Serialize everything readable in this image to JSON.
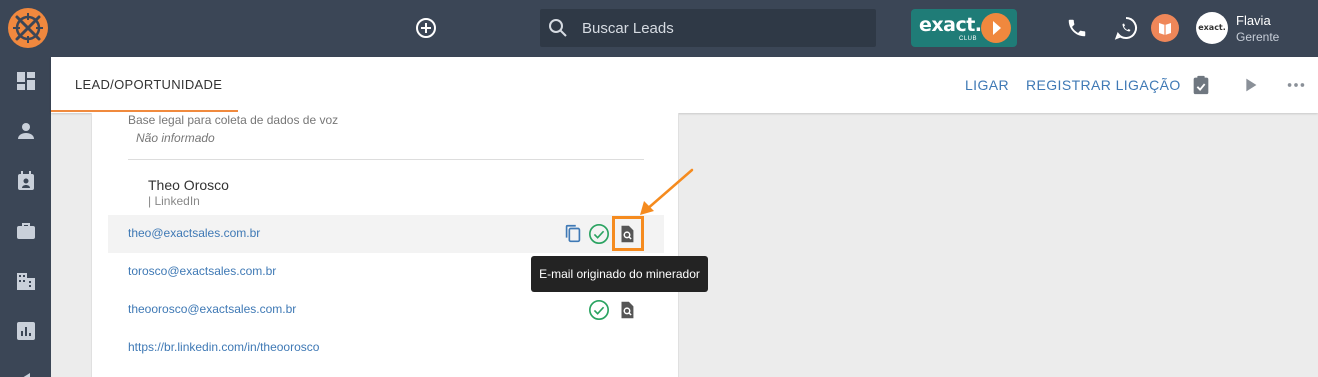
{
  "topbar": {
    "search_placeholder": "Buscar Leads",
    "club_logo_text": "exact.",
    "club_logo_sub": "CLUB",
    "user": {
      "name": "Flavia",
      "role": "Gerente",
      "avatar_text": "exact."
    }
  },
  "sidebar": {
    "items": [
      "dashboard-icon",
      "person-icon",
      "calendar-icon",
      "briefcase-icon",
      "building-icon",
      "report-icon"
    ]
  },
  "header": {
    "tab": "LEAD/OPORTUNIDADE",
    "actions": {
      "call": "LIGAR",
      "register_call": "REGISTRAR LIGAÇÃO"
    }
  },
  "content": {
    "legal_basis_label": "Base legal para coleta de dados de voz",
    "legal_basis_value": "Não informado",
    "contact": {
      "name": "Theo Orosco",
      "source": "| LinkedIn",
      "emails": [
        "theo@exactsales.com.br",
        "torosco@exactsales.com.br",
        "theoorosco@exactsales.com.br"
      ],
      "linkedin": "https://br.linkedin.com/in/theoorosco"
    }
  },
  "tooltip": "E-mail originado do minerador",
  "colors": {
    "topbar": "#3b4656",
    "accent": "#f08a3e",
    "link": "#3f79b5",
    "verified": "#2aa361",
    "club": "#1f7c77"
  }
}
